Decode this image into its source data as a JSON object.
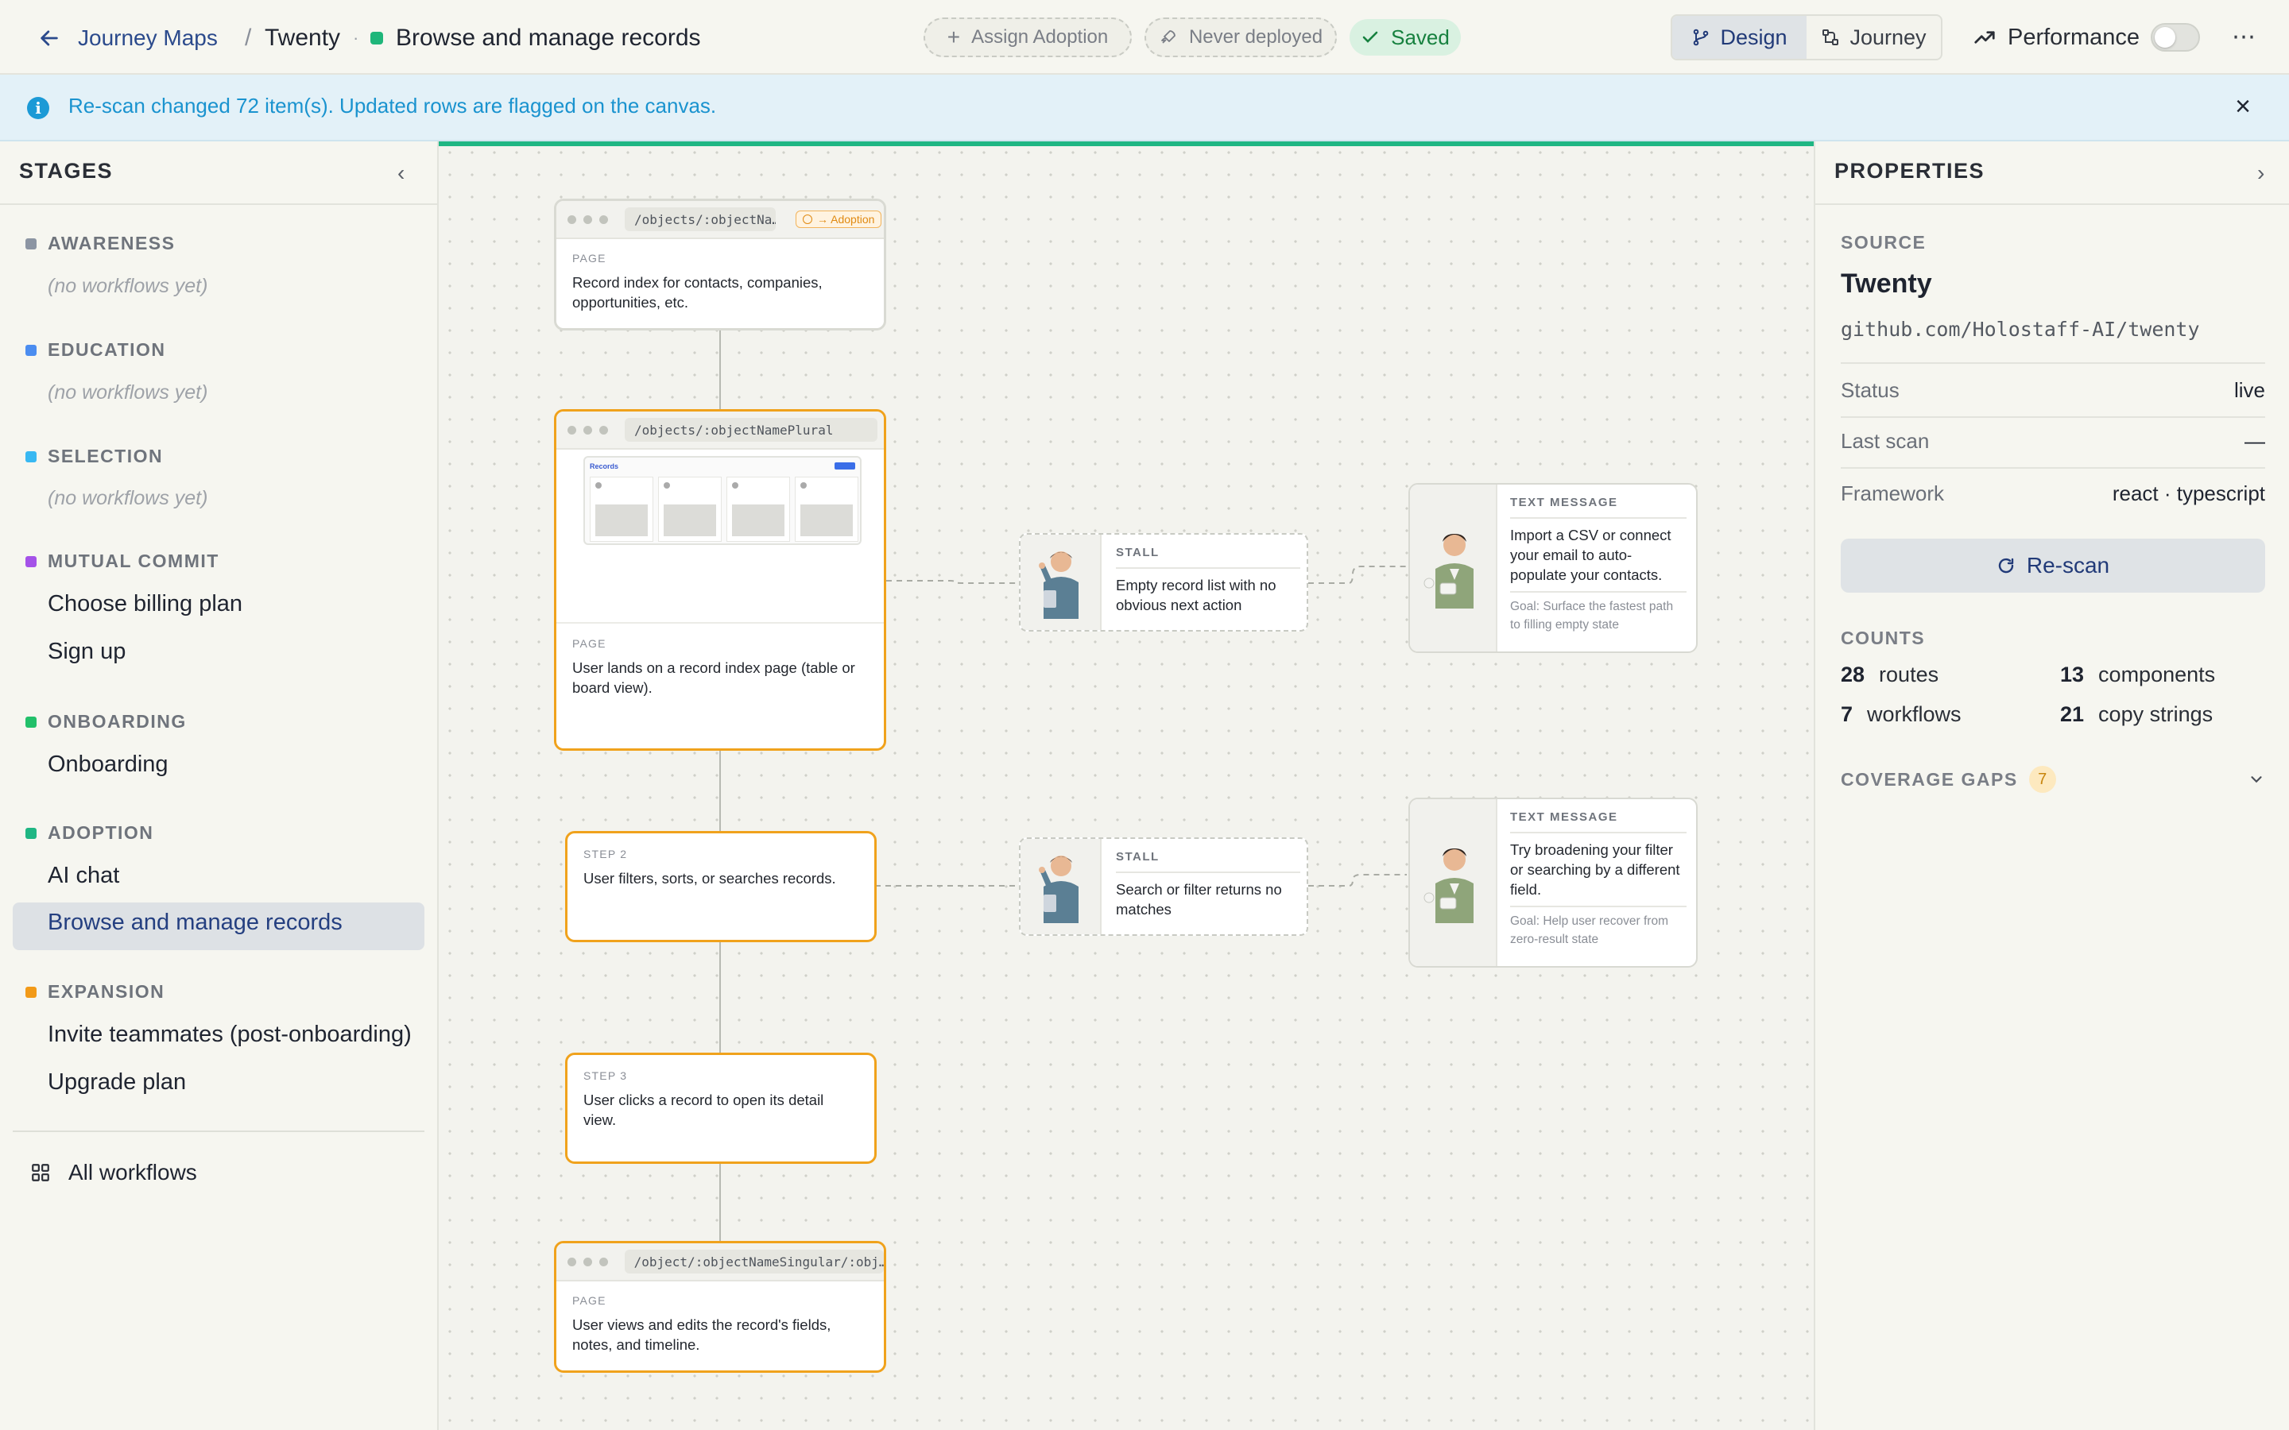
{
  "header": {
    "back_label": "Journey Maps",
    "crumb_sep": "/",
    "project": "Twenty",
    "dot_sep": "·",
    "workflow": "Browse and manage records",
    "assign_label": "Assign Adoption",
    "deploy_label": "Never deployed",
    "saved_label": "Saved",
    "view_tabs": [
      {
        "label": "Design",
        "active": true
      },
      {
        "label": "Journey",
        "active": false
      }
    ],
    "performance_label": "Performance",
    "performance_on": false,
    "status_color": "#1fb67a"
  },
  "banner": {
    "message": "Re-scan changed 72 item(s). Updated rows are flagged on the canvas."
  },
  "stages_panel": {
    "title": "STAGES",
    "empty_label": "(no workflows yet)",
    "stages": [
      {
        "name": "AWARENESS",
        "color": "#8c95a3",
        "workflows": []
      },
      {
        "name": "EDUCATION",
        "color": "#4b8df0",
        "workflows": []
      },
      {
        "name": "SELECTION",
        "color": "#38b8f2",
        "workflows": []
      },
      {
        "name": "MUTUAL COMMIT",
        "color": "#a452e8",
        "workflows": [
          "Choose billing plan",
          "Sign up"
        ]
      },
      {
        "name": "ONBOARDING",
        "color": "#22c06a",
        "workflows": [
          "Onboarding"
        ]
      },
      {
        "name": "ADOPTION",
        "color": "#1fb683",
        "workflows": [
          "AI chat",
          "Browse and manage records"
        ]
      },
      {
        "name": "EXPANSION",
        "color": "#f29a18",
        "workflows": [
          "Invite teammates (post-onboarding)",
          "Upgrade plan"
        ]
      }
    ],
    "active_workflow": "Browse and manage records",
    "all_workflows_label": "All workflows"
  },
  "canvas": {
    "cards": [
      {
        "kind": "page",
        "url": "/objects/:objectNa…",
        "badge": "→ Adoption",
        "kicker": "PAGE",
        "text": "Record index for contacts, companies, opportunities, etc."
      },
      {
        "kind": "page",
        "url": "/objects/:objectNamePlural",
        "kicker": "PAGE",
        "text": "User lands on a record index page (table or board view).",
        "preview_title": "Records"
      },
      {
        "kind": "step",
        "kicker": "STEP 2",
        "text": "User filters, sorts, or searches records."
      },
      {
        "kind": "step",
        "kicker": "STEP 3",
        "text": "User clicks a record to open its detail view."
      },
      {
        "kind": "page",
        "url": "/object/:objectNameSingular/:obj…",
        "kicker": "PAGE",
        "text": "User views and edits the record's fields, notes, and timeline."
      }
    ],
    "stalls": [
      {
        "kicker": "STALL",
        "text": "Empty record list with no obvious next action"
      },
      {
        "kicker": "STALL",
        "text": "Search or filter returns no matches"
      }
    ],
    "messages": [
      {
        "kicker": "TEXT MESSAGE",
        "text": "Import a CSV or connect your email to auto-populate your contacts.",
        "goal": "Goal: Surface the fastest path to filling empty state"
      },
      {
        "kicker": "TEXT MESSAGE",
        "text": "Try broadening your filter or searching by a different field.",
        "goal": "Goal: Help user recover from zero-result state"
      }
    ]
  },
  "properties": {
    "title": "PROPERTIES",
    "source_label": "SOURCE",
    "source_name": "Twenty",
    "source_repo": "github.com/Holostaff-AI/twenty",
    "rows": [
      {
        "key": "Status",
        "value": "live"
      },
      {
        "key": "Last scan",
        "value": "—"
      },
      {
        "key": "Framework",
        "value": "react · typescript"
      }
    ],
    "rescan_label": "Re-scan",
    "counts_label": "COUNTS",
    "counts": [
      {
        "value": "28",
        "label": "routes"
      },
      {
        "value": "13",
        "label": "components"
      },
      {
        "value": "7",
        "label": "workflows"
      },
      {
        "value": "21",
        "label": "copy strings"
      }
    ],
    "coverage_label": "COVERAGE GAPS",
    "coverage_count": "7"
  }
}
